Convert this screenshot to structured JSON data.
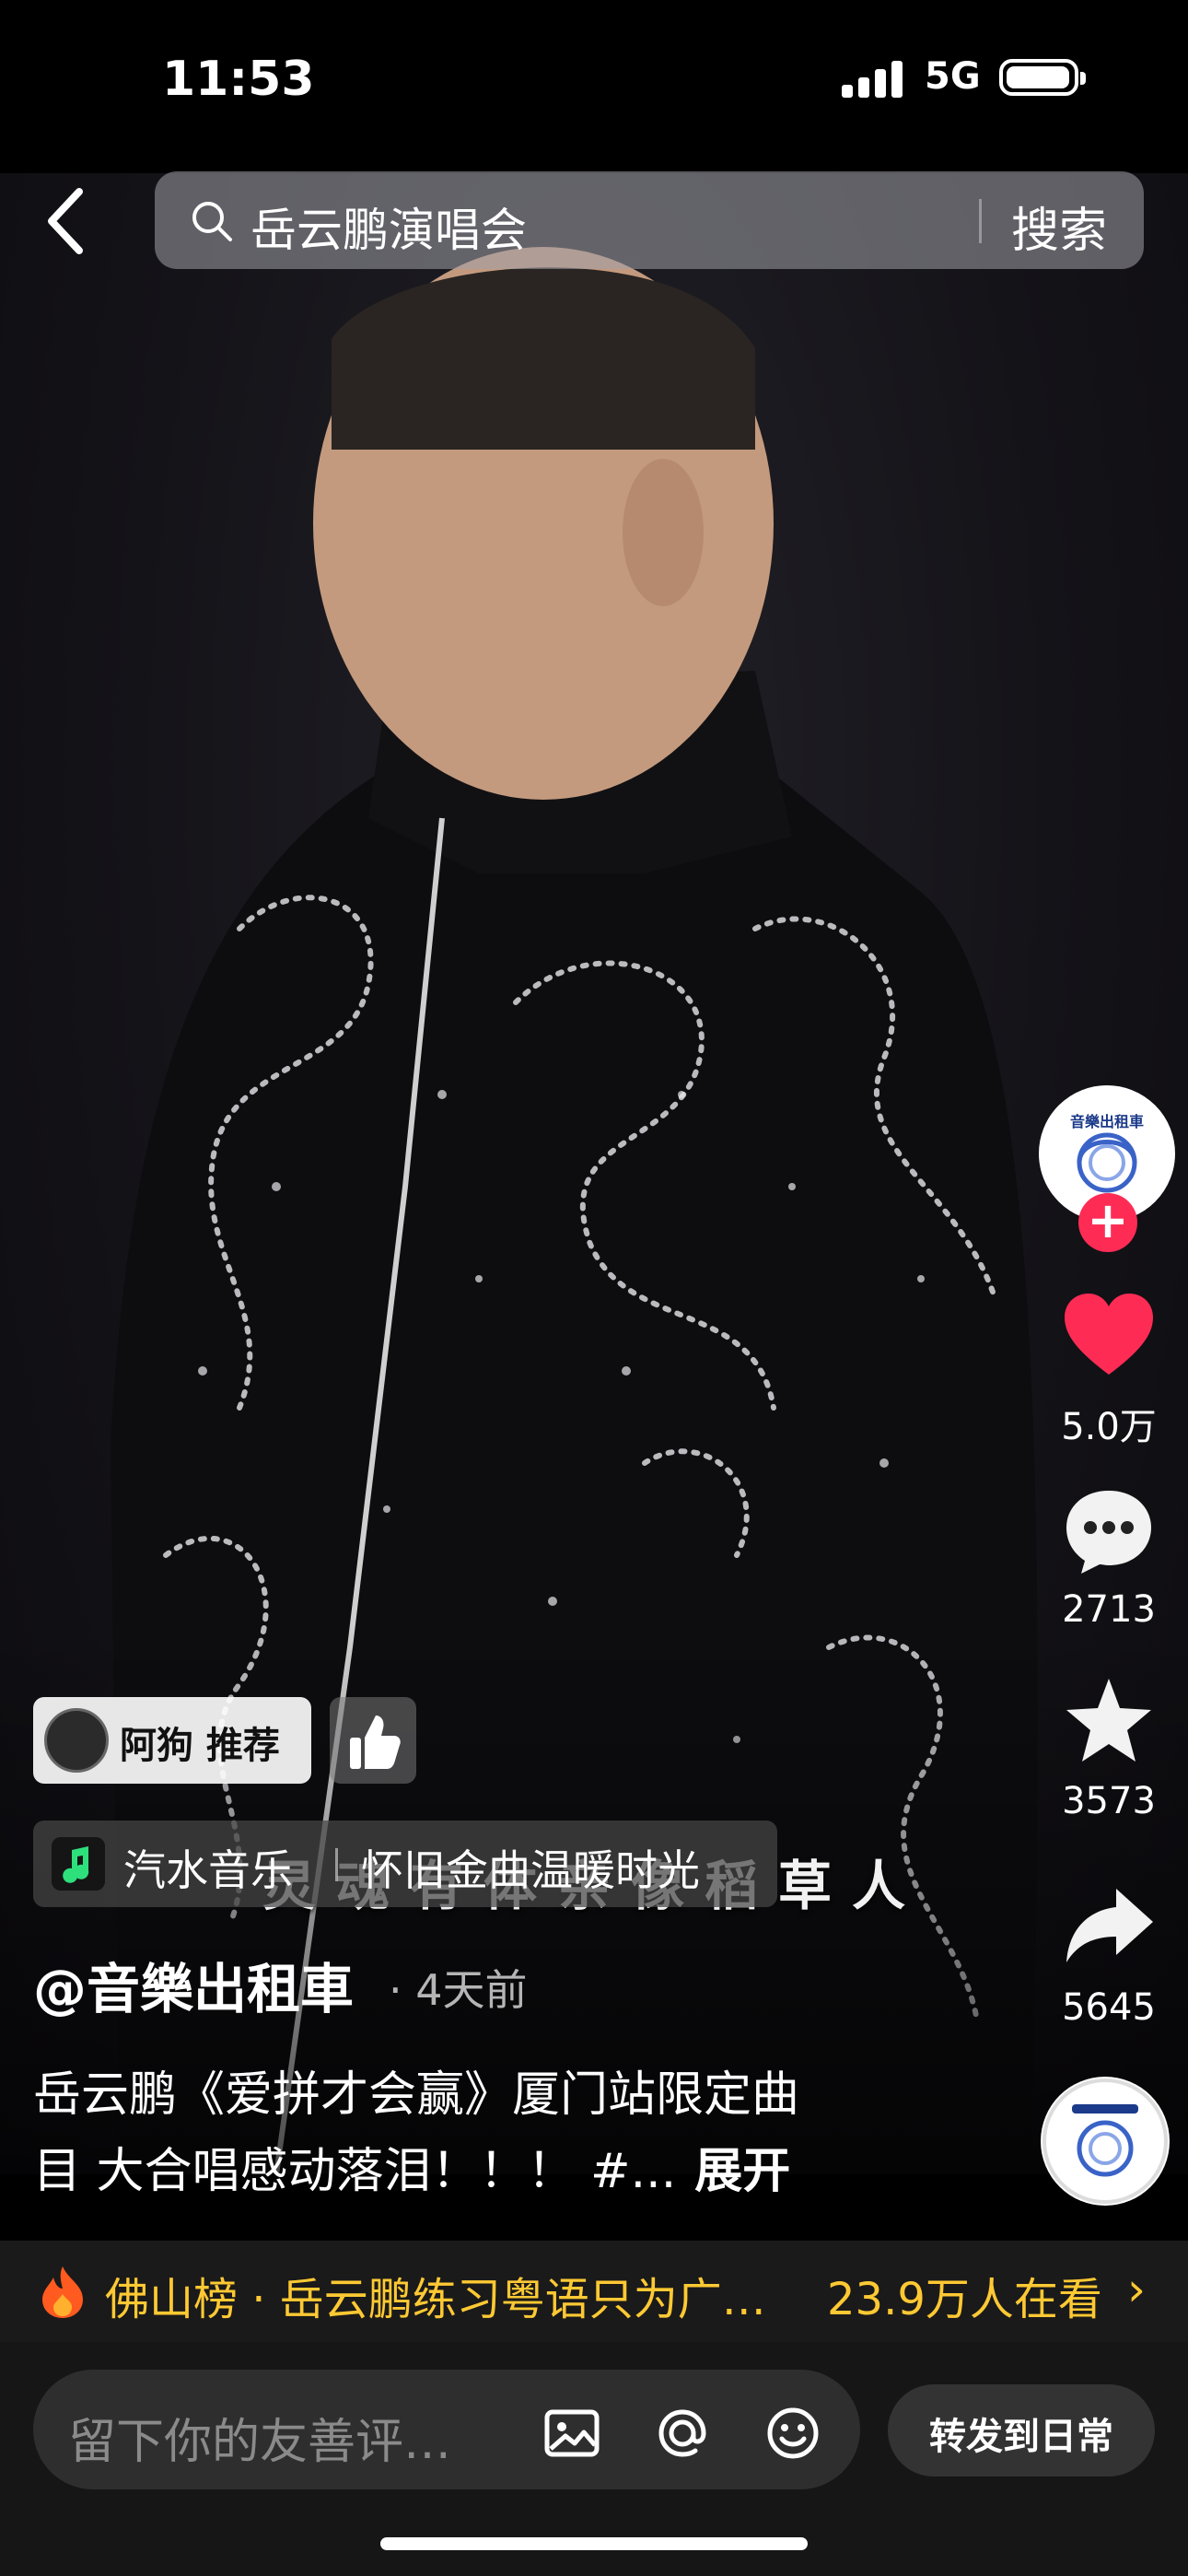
{
  "status_bar": {
    "time": "11:53",
    "network": "5G"
  },
  "search": {
    "query": "岳云鹏演唱会",
    "button": "搜索"
  },
  "video": {
    "lyric": "灵魂有体亲像稻草人"
  },
  "recommend": {
    "label": "阿狗 推荐"
  },
  "music": {
    "app": "汽水音乐",
    "title": "怀旧金曲温暖时光"
  },
  "post": {
    "author": "@音樂出租車",
    "time": "· 4天前",
    "caption_line1": "岳云鹏《爱拼才会赢》厦门站限定曲",
    "caption_line2": "目 大合唱感动落泪！！！ #...",
    "expand": "展开"
  },
  "rail": {
    "avatar_text": "音樂出租車",
    "likes": "5.0万",
    "comments": "2713",
    "favorites": "3573",
    "shares": "5645"
  },
  "trending": {
    "text": "佛山榜 · 岳云鹏练习粤语只为广…",
    "count": "23.9万人在看",
    "chevron": "›"
  },
  "comment_bar": {
    "placeholder": "留下你的友善评…",
    "share_daily": "转发到日常"
  },
  "icons": [
    "back-icon",
    "search-icon",
    "heart-icon",
    "comment-icon",
    "star-icon",
    "share-icon",
    "fire-icon",
    "image-icon",
    "at-icon",
    "emoji-icon",
    "plus-icon",
    "thumbs-up-icon"
  ],
  "colors": {
    "like_red": "#fe2c55",
    "trend_yellow": "#ffc933",
    "background": "#000000"
  }
}
